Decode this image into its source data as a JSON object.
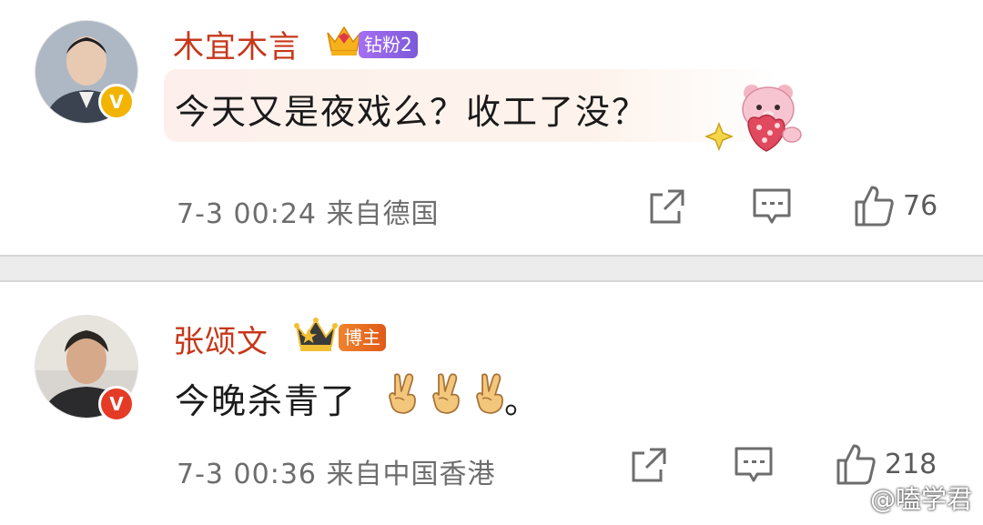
{
  "comments": [
    {
      "username": "木宜木言",
      "badge": "钻粉2",
      "text": "今天又是夜戏么？收工了没？",
      "timestamp": "7-3 00:24",
      "source": "来自德国",
      "likes": "76"
    },
    {
      "username": "张颂文",
      "badge": "博主",
      "text": "今晚杀青了",
      "emoji": [
        "✌",
        "✌",
        "✌"
      ],
      "punctuation": "。",
      "timestamp": "7-3 00:36",
      "source": "来自中国香港",
      "likes": "218"
    }
  ],
  "watermark": "@嗑学君",
  "colors": {
    "username": "#c6371a",
    "meta": "#6d6d6d",
    "verify_gold": "#f2b400",
    "verify_red": "#e53a25",
    "badge_purple": "#8a62e0",
    "badge_orange": "#e8701f"
  },
  "icons": [
    "share-icon",
    "reply-icon",
    "like-icon",
    "verified-icon",
    "crown-icon",
    "victory-hand-emoji",
    "bear-sticker"
  ]
}
